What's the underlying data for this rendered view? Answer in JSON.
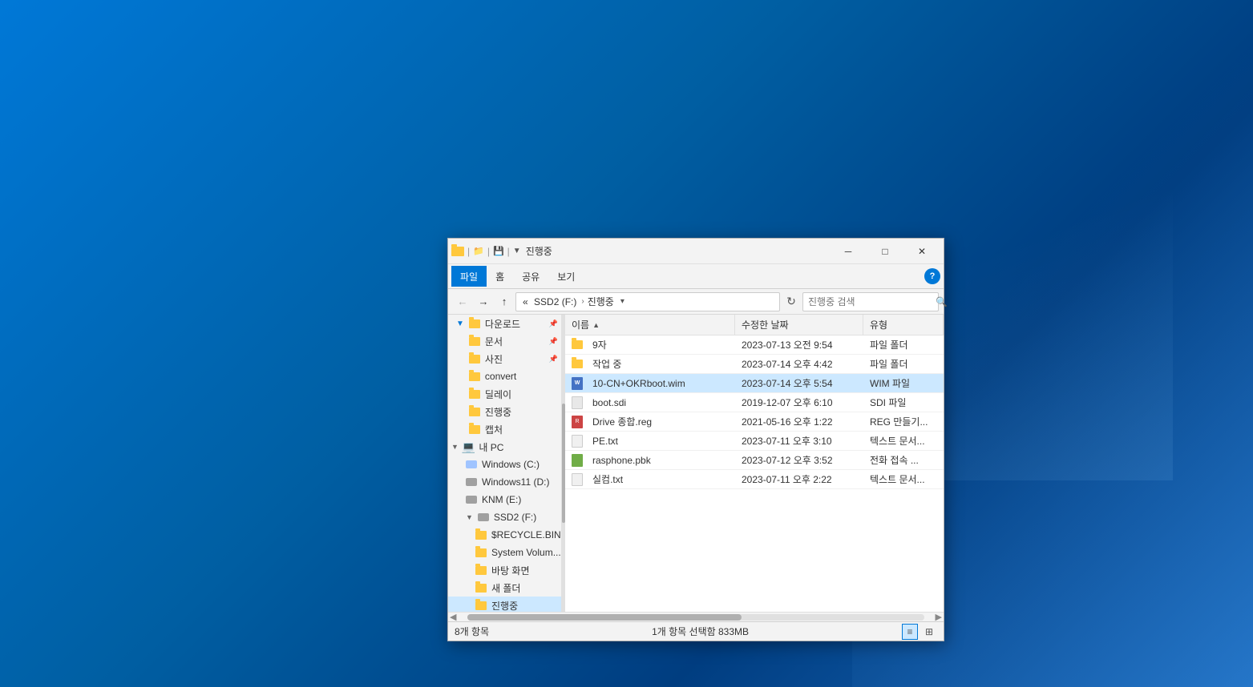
{
  "desktop": {
    "background": "Windows 10 blue gradient"
  },
  "window": {
    "title": "진행중",
    "title_bar": {
      "icon": "folder",
      "separator": "|",
      "down_arrow": "▼",
      "minimize": "─",
      "maximize": "□",
      "close": "✕"
    }
  },
  "ribbon": {
    "tabs": [
      {
        "label": "파일",
        "active": true
      },
      {
        "label": "홈",
        "active": false
      },
      {
        "label": "공유",
        "active": false
      },
      {
        "label": "보기",
        "active": false
      }
    ],
    "help_icon": "?"
  },
  "address_bar": {
    "back": "←",
    "forward": "→",
    "up": "↑",
    "path_parts": [
      "SSD2 (F:)",
      "진행중"
    ],
    "path_separator": "»",
    "dropdown_icon": "▾",
    "refresh": "↻",
    "search_placeholder": "진행중 검색",
    "search_icon": "🔍"
  },
  "sidebar": {
    "items": [
      {
        "label": "다운로드",
        "type": "folder",
        "pinned": true,
        "indent": 0
      },
      {
        "label": "문서",
        "type": "folder",
        "pinned": true,
        "indent": 0
      },
      {
        "label": "사진",
        "type": "folder",
        "pinned": true,
        "indent": 0
      },
      {
        "label": "convert",
        "type": "folder",
        "pinned": false,
        "indent": 0
      },
      {
        "label": "딜레이",
        "type": "folder",
        "pinned": false,
        "indent": 0
      },
      {
        "label": "진행중",
        "type": "folder",
        "pinned": false,
        "indent": 0
      },
      {
        "label": "캡처",
        "type": "folder",
        "pinned": false,
        "indent": 0
      },
      {
        "label": "내 PC",
        "type": "pc",
        "indent": 0
      },
      {
        "label": "Windows (C:)",
        "type": "drive",
        "indent": 1
      },
      {
        "label": "Windows11 (D:)",
        "type": "drive",
        "indent": 1
      },
      {
        "label": "KNM (E:)",
        "type": "drive",
        "indent": 1
      },
      {
        "label": "SSD2 (F:)",
        "type": "drive",
        "indent": 1,
        "expanded": true
      },
      {
        "label": "$RECYCLE.BIN",
        "type": "folder",
        "indent": 2
      },
      {
        "label": "System Volum...",
        "type": "folder",
        "indent": 2
      },
      {
        "label": "바탕 화면",
        "type": "folder",
        "indent": 2
      },
      {
        "label": "새 폴더",
        "type": "folder",
        "indent": 2
      },
      {
        "label": "진행중",
        "type": "folder",
        "indent": 2,
        "selected": true
      }
    ]
  },
  "file_list": {
    "columns": [
      {
        "label": "이름",
        "sort_arrow": "▲"
      },
      {
        "label": "수정한 날짜"
      },
      {
        "label": "유형"
      }
    ],
    "files": [
      {
        "name": "9자",
        "type": "folder",
        "date": "2023-07-13 오전 9:54",
        "kind": "파일 폴더"
      },
      {
        "name": "작업 중",
        "type": "folder",
        "date": "2023-07-14 오후 4:42",
        "kind": "파일 폴더"
      },
      {
        "name": "10-CN+OKRboot.wim",
        "type": "wim",
        "date": "2023-07-14 오후 5:54",
        "kind": "WIM 파일",
        "selected": true
      },
      {
        "name": "boot.sdi",
        "type": "sdi",
        "date": "2019-12-07 오후 6:10",
        "kind": "SDI 파일"
      },
      {
        "name": "Drive 종합.reg",
        "type": "reg",
        "date": "2021-05-16 오후 1:22",
        "kind": "REG 만들기..."
      },
      {
        "name": "PE.txt",
        "type": "txt",
        "date": "2023-07-11 오후 3:10",
        "kind": "텍스트 문서..."
      },
      {
        "name": "rasphone.pbk",
        "type": "pbk",
        "date": "2023-07-12 오후 3:52",
        "kind": "전화 접속 ..."
      },
      {
        "name": "실컴.txt",
        "type": "txt",
        "date": "2023-07-11 오후 2:22",
        "kind": "텍스트 문서..."
      }
    ]
  },
  "status_bar": {
    "item_count": "8개 항목",
    "selected": "1개 항목 선택함 833MB",
    "view_list": "≡",
    "view_tiles": "⊞"
  }
}
